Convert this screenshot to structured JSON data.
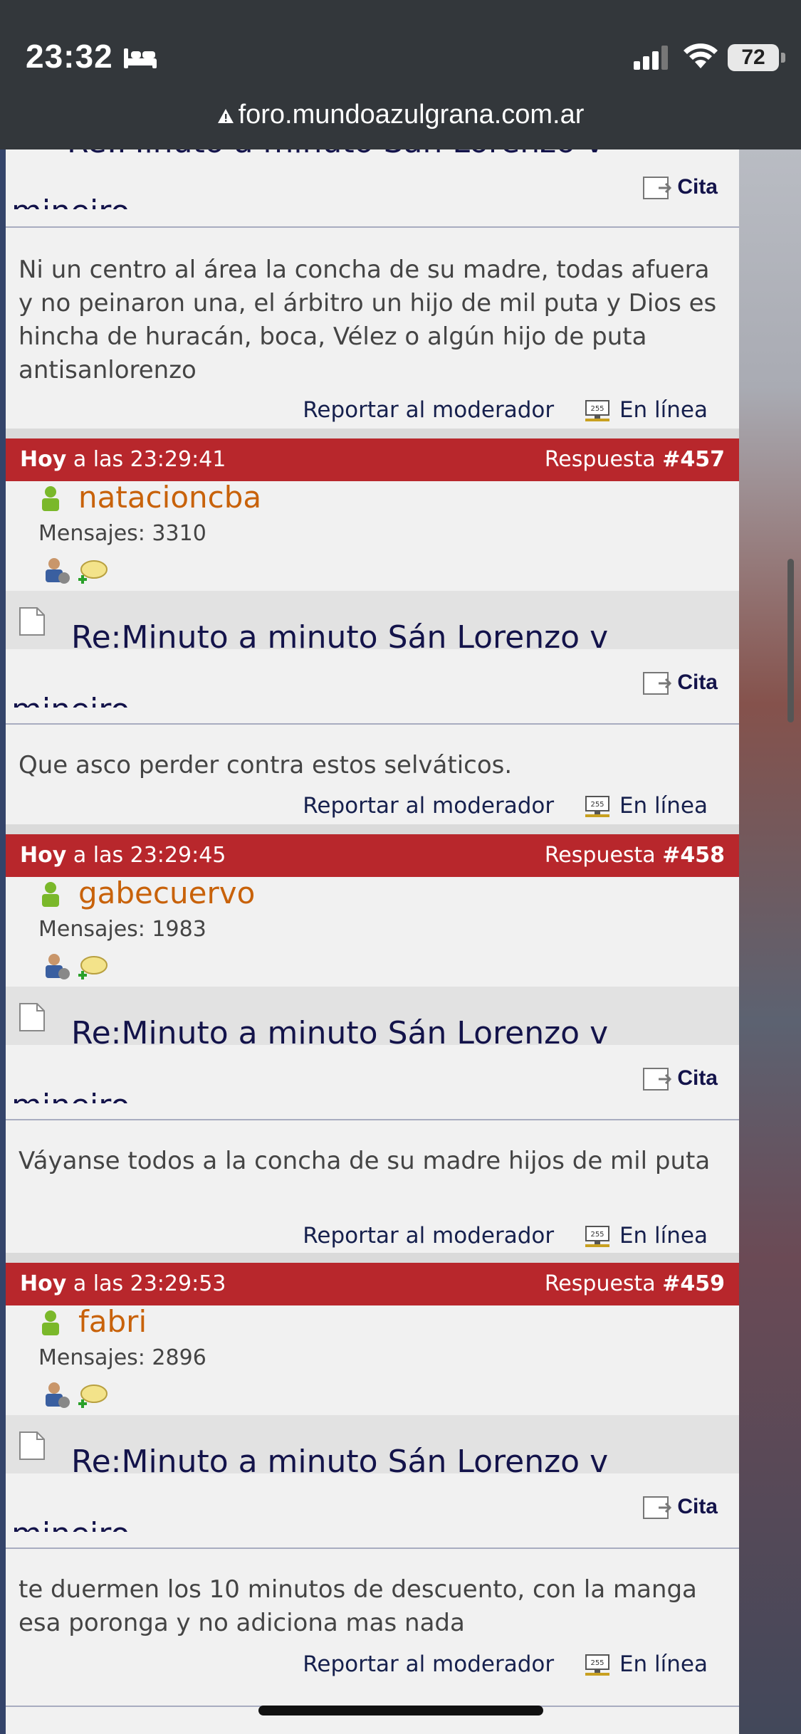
{
  "status": {
    "time": "23:32",
    "battery": "72"
  },
  "browser": {
    "url": "foro.mundoazulgrana.com.ar"
  },
  "top_post": {
    "title": "Re:Minuto a minuto Sán Lorenzo v",
    "title_cut": "mineiro",
    "quote_label": "Cita",
    "body": "Ni un centro al área la concha de su madre, todas afuera y no peinaron una, el árbitro un hijo de mil puta y Dios es hincha de huracán, boca, Vélez o algún hijo de puta antisanlorenzo",
    "report_label": "Reportar al moderador",
    "online_label": "En línea"
  },
  "posts": [
    {
      "day": "Hoy",
      "time_text": "a las 23:29:41",
      "reply_label": "Respuesta",
      "reply_number": "#457",
      "username": "natacioncba",
      "messages": "Mensajes: 3310",
      "title": "Re:Minuto a minuto Sán Lorenzo v",
      "title_cut": "mineiro",
      "quote_label": "Cita",
      "body": "Que asco perder contra estos selváticos.",
      "report_label": "Reportar al moderador",
      "online_label": "En línea"
    },
    {
      "day": "Hoy",
      "time_text": "a las 23:29:45",
      "reply_label": "Respuesta",
      "reply_number": "#458",
      "username": "gabecuervo",
      "messages": "Mensajes: 1983",
      "title": "Re:Minuto a minuto Sán Lorenzo v",
      "title_cut": "mineiro",
      "quote_label": "Cita",
      "body": "Váyanse todos a la concha de su madre hijos de mil puta",
      "report_label": "Reportar al moderador",
      "online_label": "En línea"
    },
    {
      "day": "Hoy",
      "time_text": "a las 23:29:53",
      "reply_label": "Respuesta",
      "reply_number": "#459",
      "username": "fabri",
      "messages": "Mensajes: 2896",
      "title": "Re:Minuto a minuto Sán Lorenzo v",
      "title_cut": "mineiro",
      "quote_label": "Cita",
      "body": "te duermen los 10 minutos de descuento, con la manga esa poronga y no adiciona mas nada",
      "report_label": "Reportar al moderador",
      "online_label": "En línea"
    }
  ],
  "icons": {
    "user": "user-online-icon",
    "profile": "profile-icon",
    "pm": "send-pm-icon",
    "doc": "document-icon",
    "quote": "quote-icon",
    "online": "online-status-icon"
  },
  "colors": {
    "header_red": "#b8272c",
    "username_orange": "#c8620a",
    "title_navy": "#13134a"
  }
}
